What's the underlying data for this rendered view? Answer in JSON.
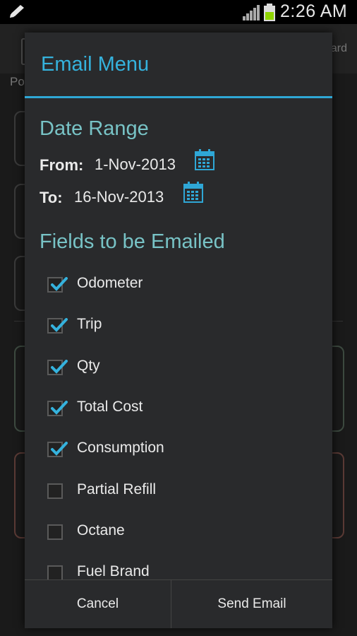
{
  "status_bar": {
    "time": "2:26 AM",
    "icons": [
      "pencil-icon",
      "signal-icon",
      "battery-icon"
    ]
  },
  "background": {
    "header_right_text": "ard",
    "tab_text": "Po"
  },
  "dialog": {
    "title": "Email Menu",
    "date_range": {
      "heading": "Date Range",
      "from_label": "From:",
      "from_value": "1-Nov-2013",
      "to_label": "To:",
      "to_value": "16-Nov-2013"
    },
    "fields": {
      "heading": "Fields to be Emailed",
      "items": [
        {
          "label": "Odometer",
          "checked": true
        },
        {
          "label": "Trip",
          "checked": true
        },
        {
          "label": "Qty",
          "checked": true
        },
        {
          "label": "Total Cost",
          "checked": true
        },
        {
          "label": "Consumption",
          "checked": true
        },
        {
          "label": "Partial Refill",
          "checked": false
        },
        {
          "label": "Octane",
          "checked": false
        },
        {
          "label": "Fuel Brand",
          "checked": false
        }
      ]
    },
    "buttons": {
      "cancel": "Cancel",
      "send": "Send Email"
    }
  },
  "colors": {
    "accent": "#35b2dd",
    "heading": "#78c3c6",
    "dialog_bg": "#292a2c"
  }
}
